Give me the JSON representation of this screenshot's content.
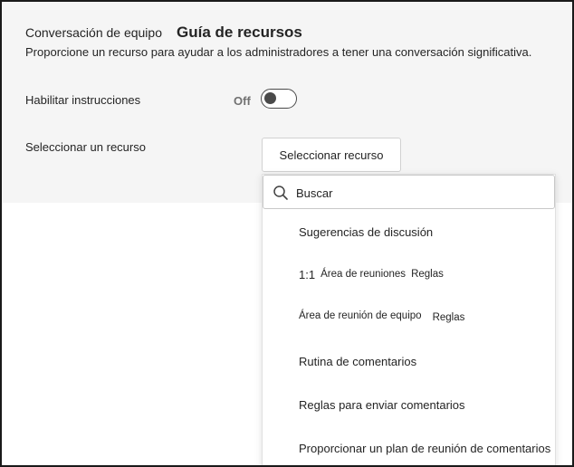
{
  "header": {
    "label": "Conversación de equipo",
    "title": "Guía de recursos",
    "description": "Proporcione un recurso para ayudar a los administradores a tener una conversación significativa."
  },
  "instructions": {
    "label": "Habilitar instrucciones",
    "state": "Off",
    "enabled": false
  },
  "resource": {
    "label": "Seleccionar un recurso",
    "button_label": "Seleccionar recurso"
  },
  "dropdown": {
    "search_placeholder": "Buscar",
    "options": [
      {
        "text": "Sugerencias de discusión"
      },
      {
        "prefix": "1:1",
        "main": "Área de reuniones",
        "suffix": "Reglas"
      },
      {
        "main": "Área de reunión de equipo",
        "suffix": "Reglas"
      },
      {
        "text": "Rutina de comentarios"
      },
      {
        "text": "Reglas para enviar comentarios"
      },
      {
        "text": "Proporcionar un plan de reunión de comentarios"
      }
    ]
  },
  "icons": {
    "search": "search-icon"
  },
  "colors": {
    "panel_bg": "#f5f5f5",
    "text": "#242424",
    "toggle_off": "#4a4a4a",
    "toggle_state_text": "#707070"
  }
}
